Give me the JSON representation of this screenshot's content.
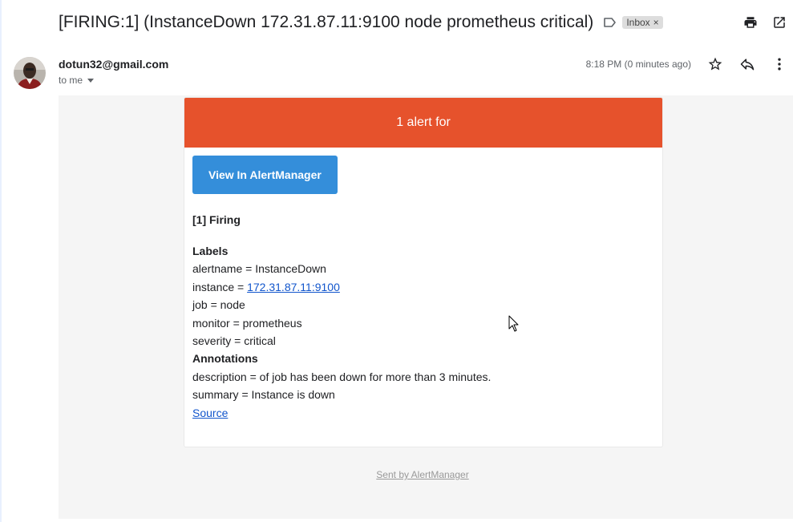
{
  "email": {
    "subject": "[FIRING:1] (InstanceDown 172.31.87.11:9100 node prometheus critical)",
    "inbox_chip": "Inbox",
    "chip_close": "×",
    "sender": "dotun32@gmail.com",
    "recipient": "to me",
    "timestamp": "8:18 PM (0 minutes ago)"
  },
  "icons": {
    "label": "label-arrow-icon",
    "print": "printer-icon",
    "open_new": "open-in-new-window-icon",
    "star": "star-icon",
    "reply": "reply-icon",
    "more": "more-vertical-icon"
  },
  "alert": {
    "header": "1 alert for",
    "button_label": "View In AlertManager",
    "firing_title": "[1] Firing",
    "labels_title": "Labels",
    "alertname": "alertname = InstanceDown",
    "instance_prefix": "instance = ",
    "instance_link": "172.31.87.11:9100",
    "job": "job = node",
    "monitor": "monitor = prometheus",
    "severity": "severity = critical",
    "annotations_title": "Annotations",
    "description": "description = of job has been down for more than 3 minutes.",
    "summary": "summary = Instance is down",
    "source_link": "Source",
    "footer": "Sent by AlertManager"
  },
  "colors": {
    "alert_header": "#e6522c",
    "button": "#348eda",
    "link": "#1155cc",
    "body_bg": "#f5f5f5"
  }
}
